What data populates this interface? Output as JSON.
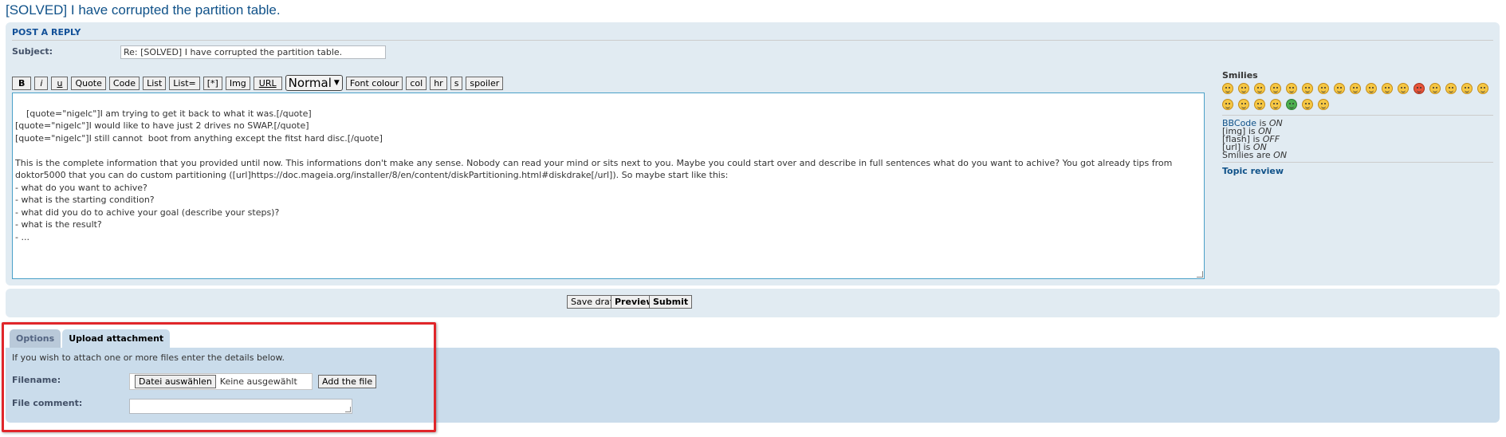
{
  "page": {
    "title": "[SOLVED] I have corrupted the partition table."
  },
  "post_form": {
    "heading": "POST A REPLY",
    "subject_label": "Subject:",
    "subject_value": "Re: [SOLVED] I have corrupted the partition table.",
    "toolbar": {
      "bold": "B",
      "italic": "i",
      "underline": "u",
      "quote": "Quote",
      "code": "Code",
      "list": "List",
      "list_eq": "List=",
      "list_item": "[*]",
      "img": "Img",
      "url": "URL",
      "font_size": "Normal",
      "font_colour": "Font colour",
      "col": "col",
      "hr": "hr",
      "s": "s",
      "spoiler": "spoiler"
    },
    "message": "[quote=\"nigelc\"]I am trying to get it back to what it was.[/quote]\n[quote=\"nigelc\"]I would like to have just 2 drives no SWAP.[/quote]\n[quote=\"nigelc\"]I still cannot  boot from anything except the fitst hard disc.[/quote]\n\nThis is the complete information that you provided until now. This informations don't make any sense. Nobody can read your mind or sits next to you. Maybe you could start over and describe in full sentences what do you want to achive? You got already tips from doktor5000 that you can do custom partitioning ([url]https://doc.mageia.org/installer/8/en/content/diskPartitioning.html#diskdrake[/url]). So maybe start like this:\n- what do you want to achive?\n- what is the starting condition?\n- what did you do to achive your goal (describe your steps)?\n- what is the result?\n- ..."
  },
  "sidebar": {
    "smilies_title": "Smilies",
    "smiley_count": 24,
    "bbcode_link": "BBCode",
    "bbcode_is": " is ",
    "bbcode_state": "ON",
    "img_label": "[img] is ",
    "img_state": "ON",
    "flash_label": "[flash] is ",
    "flash_state": "OFF",
    "url_label": "[url] is ",
    "url_state": "ON",
    "smilies_label": "Smilies are ",
    "smilies_state": "ON",
    "topic_review": "Topic review"
  },
  "actions": {
    "save_draft": "Save draft",
    "preview": "Preview",
    "submit": "Submit"
  },
  "tabs": [
    {
      "label": "Options",
      "active": false
    },
    {
      "label": "Upload attachment",
      "active": true
    }
  ],
  "attachment": {
    "intro": "If you wish to attach one or more files enter the details below.",
    "filename_label": "Filename:",
    "choose_button": "Datei auswählen",
    "no_file": "Keine ausgewählt",
    "add_file": "Add the file",
    "comment_label": "File comment:"
  },
  "colors": {
    "accent": "#105289",
    "panel": "#e1ebf2",
    "attach_panel": "#cadceb",
    "highlight": "#e0262a"
  }
}
